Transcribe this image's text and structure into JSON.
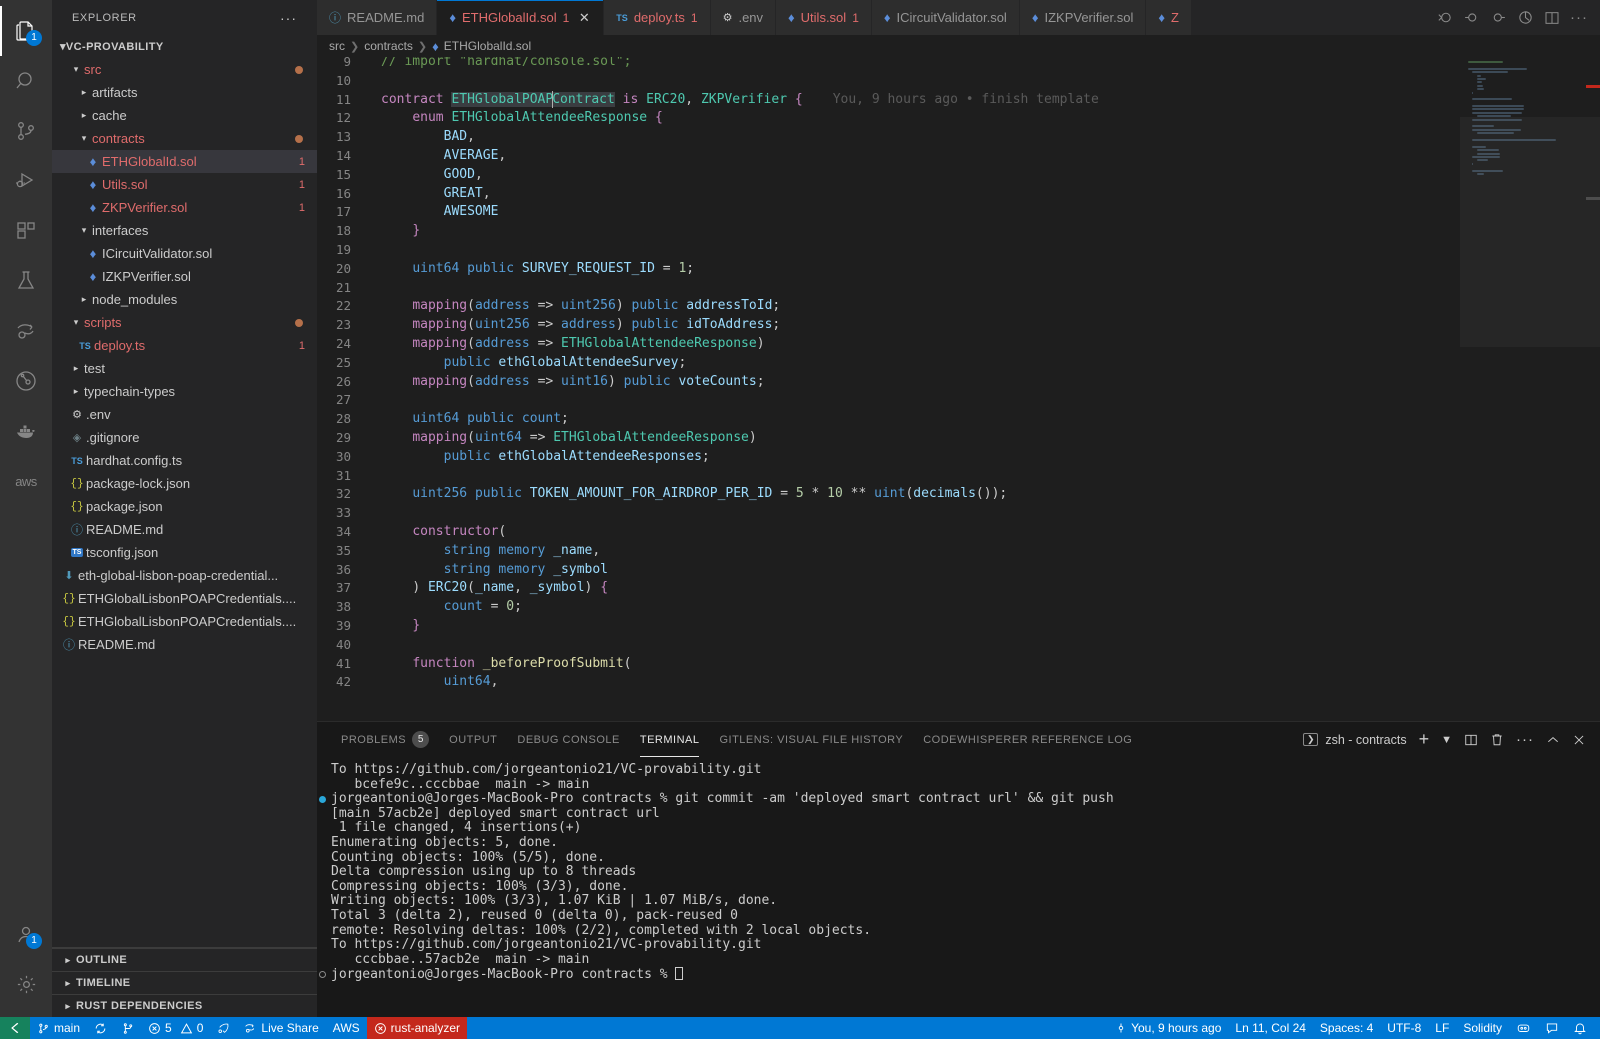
{
  "activitybar": {
    "items": [
      {
        "name": "explorer",
        "icon": "files-icon",
        "badge": "1",
        "active": true
      },
      {
        "name": "search",
        "icon": "search-icon",
        "badge": "",
        "active": false
      },
      {
        "name": "source-control",
        "icon": "source-control-icon",
        "badge": "",
        "active": false
      },
      {
        "name": "run-and-debug",
        "icon": "run-debug-icon",
        "badge": "",
        "active": false
      },
      {
        "name": "extensions",
        "icon": "extensions-icon",
        "badge": "",
        "active": false
      },
      {
        "name": "testing",
        "icon": "beaker-icon",
        "badge": "",
        "active": false
      },
      {
        "name": "live-share",
        "icon": "live-share-icon",
        "badge": "",
        "active": false
      },
      {
        "name": "gitlens",
        "icon": "gitlens-icon",
        "badge": "",
        "active": false
      },
      {
        "name": "docker",
        "icon": "docker-icon",
        "badge": "",
        "active": false
      },
      {
        "name": "aws-toolkit",
        "icon": "aws-icon",
        "badge": "",
        "active": false
      }
    ],
    "bottom": [
      {
        "name": "accounts",
        "icon": "account-icon",
        "badge": "1"
      },
      {
        "name": "manage",
        "icon": "gear-icon",
        "badge": ""
      }
    ]
  },
  "sidebar": {
    "title": "EXPLORER",
    "more_label": "···",
    "root": "VC-PROVABILITY",
    "tree": [
      {
        "label": "src",
        "indent": 1,
        "type": "folder",
        "expanded": true,
        "color": "err",
        "dot": true
      },
      {
        "label": "artifacts",
        "indent": 2,
        "type": "folder",
        "expanded": false,
        "color": "norm"
      },
      {
        "label": "cache",
        "indent": 2,
        "type": "folder",
        "expanded": false,
        "color": "norm"
      },
      {
        "label": "contracts",
        "indent": 2,
        "type": "folder",
        "expanded": true,
        "color": "err",
        "dot": true
      },
      {
        "label": "ETHGlobalId.sol",
        "indent": 3,
        "type": "sol",
        "color": "err",
        "count": "1",
        "selected": true
      },
      {
        "label": "Utils.sol",
        "indent": 3,
        "type": "sol",
        "color": "err",
        "count": "1"
      },
      {
        "label": "ZKPVerifier.sol",
        "indent": 3,
        "type": "sol",
        "color": "err",
        "count": "1"
      },
      {
        "label": "interfaces",
        "indent": 2,
        "type": "folder",
        "expanded": true,
        "color": "norm"
      },
      {
        "label": "ICircuitValidator.sol",
        "indent": 3,
        "type": "sol",
        "color": "norm"
      },
      {
        "label": "IZKPVerifier.sol",
        "indent": 3,
        "type": "sol",
        "color": "norm"
      },
      {
        "label": "node_modules",
        "indent": 2,
        "type": "folder",
        "expanded": false,
        "color": "norm"
      },
      {
        "label": "scripts",
        "indent": 1,
        "type": "folder",
        "expanded": true,
        "color": "err",
        "dot": true
      },
      {
        "label": "deploy.ts",
        "indent": 2,
        "type": "ts",
        "color": "err",
        "count": "1"
      },
      {
        "label": "test",
        "indent": 1,
        "type": "folder",
        "expanded": false,
        "color": "norm"
      },
      {
        "label": "typechain-types",
        "indent": 1,
        "type": "folder",
        "expanded": false,
        "color": "norm"
      },
      {
        "label": ".env",
        "indent": 1,
        "type": "gear",
        "color": "norm"
      },
      {
        "label": ".gitignore",
        "indent": 1,
        "type": "diamond",
        "color": "norm"
      },
      {
        "label": "hardhat.config.ts",
        "indent": 1,
        "type": "ts",
        "color": "norm"
      },
      {
        "label": "package-lock.json",
        "indent": 1,
        "type": "json",
        "color": "norm"
      },
      {
        "label": "package.json",
        "indent": 1,
        "type": "json",
        "color": "norm"
      },
      {
        "label": "README.md",
        "indent": 1,
        "type": "md",
        "color": "norm"
      },
      {
        "label": "tsconfig.json",
        "indent": 1,
        "type": "tsconf",
        "color": "norm"
      },
      {
        "label": "eth-global-lisbon-poap-credential...",
        "indent": 0,
        "type": "download",
        "color": "norm"
      },
      {
        "label": "ETHGlobalLisbonPOAPCredentials....",
        "indent": 0,
        "type": "json",
        "color": "norm"
      },
      {
        "label": "ETHGlobalLisbonPOAPCredentials....",
        "indent": 0,
        "type": "json",
        "color": "norm"
      },
      {
        "label": "README.md",
        "indent": 0,
        "type": "md",
        "color": "norm"
      }
    ],
    "panels": [
      {
        "label": "OUTLINE"
      },
      {
        "label": "TIMELINE"
      },
      {
        "label": "RUST DEPENDENCIES"
      }
    ]
  },
  "tabs": [
    {
      "label": "README.md",
      "icon": "md-icon",
      "count": "",
      "active": false,
      "dirty": false,
      "err": false
    },
    {
      "label": "ETHGlobalId.sol",
      "icon": "sol-icon",
      "count": "1",
      "active": true,
      "dirty": true,
      "err": true
    },
    {
      "label": "deploy.ts",
      "icon": "ts-icon",
      "count": "1",
      "active": false,
      "dirty": false,
      "err": true
    },
    {
      "label": ".env",
      "icon": "gear-icon",
      "count": "",
      "active": false,
      "dirty": false,
      "err": false
    },
    {
      "label": "Utils.sol",
      "icon": "sol-icon",
      "count": "1",
      "active": false,
      "dirty": false,
      "err": true
    },
    {
      "label": "ICircuitValidator.sol",
      "icon": "sol-icon",
      "count": "",
      "active": false,
      "dirty": false,
      "err": false
    },
    {
      "label": "IZKPVerifier.sol",
      "icon": "sol-icon",
      "count": "",
      "active": false,
      "dirty": false,
      "err": false
    },
    {
      "label": "Z",
      "icon": "sol-icon",
      "count": "",
      "active": false,
      "dirty": false,
      "err": true
    }
  ],
  "tab_actions": [
    {
      "name": "go-back-icon"
    },
    {
      "name": "go-left-icon"
    },
    {
      "name": "go-right-icon"
    },
    {
      "name": "run-icon"
    },
    {
      "name": "split-editor-icon"
    },
    {
      "name": "more-actions-icon"
    }
  ],
  "breadcrumb": [
    "src",
    "contracts",
    "ETHGlobalId.sol"
  ],
  "editor": {
    "blame": "You, 9 hours ago • finish template",
    "first_line": 9,
    "code": [
      {
        "n": 9,
        "text": "// import \"hardhat/console.sol\";",
        "cls": "cm"
      },
      {
        "n": 10,
        "text": ""
      },
      {
        "n": 11,
        "text": "contract ETHGlobalPOAPContract is ERC20, ZKPVerifier {"
      },
      {
        "n": 12,
        "text": "    enum ETHGlobalAttendeeResponse {"
      },
      {
        "n": 13,
        "text": "        BAD,"
      },
      {
        "n": 14,
        "text": "        AVERAGE,"
      },
      {
        "n": 15,
        "text": "        GOOD,"
      },
      {
        "n": 16,
        "text": "        GREAT,"
      },
      {
        "n": 17,
        "text": "        AWESOME"
      },
      {
        "n": 18,
        "text": "    }"
      },
      {
        "n": 19,
        "text": ""
      },
      {
        "n": 20,
        "text": "    uint64 public SURVEY_REQUEST_ID = 1;"
      },
      {
        "n": 21,
        "text": ""
      },
      {
        "n": 22,
        "text": "    mapping(address => uint256) public addressToId;"
      },
      {
        "n": 23,
        "text": "    mapping(uint256 => address) public idToAddress;"
      },
      {
        "n": 24,
        "text": "    mapping(address => ETHGlobalAttendeeResponse)"
      },
      {
        "n": 25,
        "text": "        public ethGlobalAttendeeSurvey;"
      },
      {
        "n": 26,
        "text": "    mapping(address => uint16) public voteCounts;"
      },
      {
        "n": 27,
        "text": ""
      },
      {
        "n": 28,
        "text": "    uint64 public count;"
      },
      {
        "n": 29,
        "text": "    mapping(uint64 => ETHGlobalAttendeeResponse)"
      },
      {
        "n": 30,
        "text": "        public ethGlobalAttendeeResponses;"
      },
      {
        "n": 31,
        "text": ""
      },
      {
        "n": 32,
        "text": "    uint256 public TOKEN_AMOUNT_FOR_AIRDROP_PER_ID = 5 * 10 ** uint(decimals());"
      },
      {
        "n": 33,
        "text": ""
      },
      {
        "n": 34,
        "text": "    constructor("
      },
      {
        "n": 35,
        "text": "        string memory _name,"
      },
      {
        "n": 36,
        "text": "        string memory _symbol"
      },
      {
        "n": 37,
        "text": "    ) ERC20(_name, _symbol) {"
      },
      {
        "n": 38,
        "text": "        count = 0;"
      },
      {
        "n": 39,
        "text": "    }"
      },
      {
        "n": 40,
        "text": ""
      },
      {
        "n": 41,
        "text": "    function _beforeProofSubmit("
      },
      {
        "n": 42,
        "text": "        uint64,"
      }
    ]
  },
  "panel": {
    "tabs": [
      {
        "label": "PROBLEMS",
        "badge": "5",
        "active": false
      },
      {
        "label": "OUTPUT",
        "badge": "",
        "active": false
      },
      {
        "label": "DEBUG CONSOLE",
        "badge": "",
        "active": false
      },
      {
        "label": "TERMINAL",
        "badge": "",
        "active": true
      },
      {
        "label": "GITLENS: VISUAL FILE HISTORY",
        "badge": "",
        "active": false
      },
      {
        "label": "CODEWHISPERER REFERENCE LOG",
        "badge": "",
        "active": false
      }
    ],
    "terminal_name": "zsh - contracts",
    "actions": [
      {
        "name": "new-terminal-icon",
        "glyph": "+"
      },
      {
        "name": "terminal-dropdown-icon",
        "glyph": "⌄"
      },
      {
        "name": "split-terminal-icon",
        "glyph": "◫"
      },
      {
        "name": "kill-terminal-icon",
        "glyph": "🗑"
      },
      {
        "name": "panel-more-icon",
        "glyph": "···"
      },
      {
        "name": "maximize-panel-icon",
        "glyph": "∧"
      },
      {
        "name": "close-panel-icon",
        "glyph": "✕"
      }
    ],
    "terminal_lines": [
      {
        "text": "To https://github.com/jorgeantonio21/VC-provability.git",
        "marker": "none"
      },
      {
        "text": "   bcefe9c..cccbbae  main -> main",
        "marker": "none"
      },
      {
        "text": "jorgeantonio@Jorges-MacBook-Pro contracts % git commit -am 'deployed smart contract url' && git push",
        "marker": "blue"
      },
      {
        "text": "[main 57acb2e] deployed smart contract url",
        "marker": "none"
      },
      {
        "text": " 1 file changed, 4 insertions(+)",
        "marker": "none"
      },
      {
        "text": "Enumerating objects: 5, done.",
        "marker": "none"
      },
      {
        "text": "Counting objects: 100% (5/5), done.",
        "marker": "none"
      },
      {
        "text": "Delta compression using up to 8 threads",
        "marker": "none"
      },
      {
        "text": "Compressing objects: 100% (3/3), done.",
        "marker": "none"
      },
      {
        "text": "Writing objects: 100% (3/3), 1.07 KiB | 1.07 MiB/s, done.",
        "marker": "none"
      },
      {
        "text": "Total 3 (delta 2), reused 0 (delta 0), pack-reused 0",
        "marker": "none"
      },
      {
        "text": "remote: Resolving deltas: 100% (2/2), completed with 2 local objects.",
        "marker": "none"
      },
      {
        "text": "To https://github.com/jorgeantonio21/VC-provability.git",
        "marker": "none"
      },
      {
        "text": "   cccbbae..57acb2e  main -> main",
        "marker": "none"
      },
      {
        "text": "jorgeantonio@Jorges-MacBook-Pro contracts % ",
        "marker": "grey",
        "cursor": true
      }
    ]
  },
  "statusbar": {
    "left": [
      {
        "name": "remote-window",
        "label": "",
        "icon": "remote-icon",
        "style": "remote"
      },
      {
        "name": "branch",
        "label": "main",
        "icon": "branch-icon"
      },
      {
        "name": "sync",
        "label": "",
        "icon": "sync-icon"
      },
      {
        "name": "publish",
        "label": "",
        "icon": "cloud-icon"
      },
      {
        "name": "problems",
        "label": "5",
        "label2": "0",
        "icon": "error-warning-icon"
      },
      {
        "name": "codewhisperer",
        "label": "",
        "icon": "rocket-icon"
      },
      {
        "name": "live-share",
        "label": "Live Share",
        "icon": "live-share-icon"
      },
      {
        "name": "aws",
        "label": "AWS",
        "icon": ""
      },
      {
        "name": "rust-analyzer",
        "label": "rust-analyzer",
        "icon": "error-icon",
        "style": "err-red"
      }
    ],
    "right": [
      {
        "name": "git-blame",
        "label": "You, 9 hours ago",
        "icon": "git-commit-icon"
      },
      {
        "name": "cursor-position",
        "label": "Ln 11, Col 24"
      },
      {
        "name": "indentation",
        "label": "Spaces: 4"
      },
      {
        "name": "encoding",
        "label": "UTF-8"
      },
      {
        "name": "eol",
        "label": "LF"
      },
      {
        "name": "language-mode",
        "label": "Solidity"
      },
      {
        "name": "gitlens-status",
        "label": "",
        "icon": "gitlens-icon"
      },
      {
        "name": "feedback",
        "label": "",
        "icon": "feedback-icon"
      },
      {
        "name": "notifications",
        "label": "",
        "icon": "bell-icon"
      }
    ]
  },
  "colors": {
    "accent": "#0078d4",
    "error": "#e06c6c",
    "remote_green": "#16825d",
    "error_red_bg": "#c4281c",
    "modified_dot": "#b5704a"
  }
}
